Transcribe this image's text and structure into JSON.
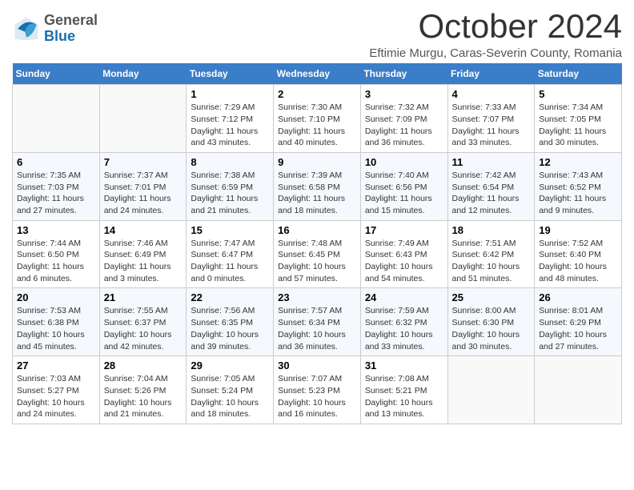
{
  "header": {
    "logo_general": "General",
    "logo_blue": "Blue",
    "month_title": "October 2024",
    "location": "Eftimie Murgu, Caras-Severin County, Romania"
  },
  "weekdays": [
    "Sunday",
    "Monday",
    "Tuesday",
    "Wednesday",
    "Thursday",
    "Friday",
    "Saturday"
  ],
  "weeks": [
    [
      {
        "day": "",
        "sunrise": "",
        "sunset": "",
        "daylight": ""
      },
      {
        "day": "",
        "sunrise": "",
        "sunset": "",
        "daylight": ""
      },
      {
        "day": "1",
        "sunrise": "Sunrise: 7:29 AM",
        "sunset": "Sunset: 7:12 PM",
        "daylight": "Daylight: 11 hours and 43 minutes."
      },
      {
        "day": "2",
        "sunrise": "Sunrise: 7:30 AM",
        "sunset": "Sunset: 7:10 PM",
        "daylight": "Daylight: 11 hours and 40 minutes."
      },
      {
        "day": "3",
        "sunrise": "Sunrise: 7:32 AM",
        "sunset": "Sunset: 7:09 PM",
        "daylight": "Daylight: 11 hours and 36 minutes."
      },
      {
        "day": "4",
        "sunrise": "Sunrise: 7:33 AM",
        "sunset": "Sunset: 7:07 PM",
        "daylight": "Daylight: 11 hours and 33 minutes."
      },
      {
        "day": "5",
        "sunrise": "Sunrise: 7:34 AM",
        "sunset": "Sunset: 7:05 PM",
        "daylight": "Daylight: 11 hours and 30 minutes."
      }
    ],
    [
      {
        "day": "6",
        "sunrise": "Sunrise: 7:35 AM",
        "sunset": "Sunset: 7:03 PM",
        "daylight": "Daylight: 11 hours and 27 minutes."
      },
      {
        "day": "7",
        "sunrise": "Sunrise: 7:37 AM",
        "sunset": "Sunset: 7:01 PM",
        "daylight": "Daylight: 11 hours and 24 minutes."
      },
      {
        "day": "8",
        "sunrise": "Sunrise: 7:38 AM",
        "sunset": "Sunset: 6:59 PM",
        "daylight": "Daylight: 11 hours and 21 minutes."
      },
      {
        "day": "9",
        "sunrise": "Sunrise: 7:39 AM",
        "sunset": "Sunset: 6:58 PM",
        "daylight": "Daylight: 11 hours and 18 minutes."
      },
      {
        "day": "10",
        "sunrise": "Sunrise: 7:40 AM",
        "sunset": "Sunset: 6:56 PM",
        "daylight": "Daylight: 11 hours and 15 minutes."
      },
      {
        "day": "11",
        "sunrise": "Sunrise: 7:42 AM",
        "sunset": "Sunset: 6:54 PM",
        "daylight": "Daylight: 11 hours and 12 minutes."
      },
      {
        "day": "12",
        "sunrise": "Sunrise: 7:43 AM",
        "sunset": "Sunset: 6:52 PM",
        "daylight": "Daylight: 11 hours and 9 minutes."
      }
    ],
    [
      {
        "day": "13",
        "sunrise": "Sunrise: 7:44 AM",
        "sunset": "Sunset: 6:50 PM",
        "daylight": "Daylight: 11 hours and 6 minutes."
      },
      {
        "day": "14",
        "sunrise": "Sunrise: 7:46 AM",
        "sunset": "Sunset: 6:49 PM",
        "daylight": "Daylight: 11 hours and 3 minutes."
      },
      {
        "day": "15",
        "sunrise": "Sunrise: 7:47 AM",
        "sunset": "Sunset: 6:47 PM",
        "daylight": "Daylight: 11 hours and 0 minutes."
      },
      {
        "day": "16",
        "sunrise": "Sunrise: 7:48 AM",
        "sunset": "Sunset: 6:45 PM",
        "daylight": "Daylight: 10 hours and 57 minutes."
      },
      {
        "day": "17",
        "sunrise": "Sunrise: 7:49 AM",
        "sunset": "Sunset: 6:43 PM",
        "daylight": "Daylight: 10 hours and 54 minutes."
      },
      {
        "day": "18",
        "sunrise": "Sunrise: 7:51 AM",
        "sunset": "Sunset: 6:42 PM",
        "daylight": "Daylight: 10 hours and 51 minutes."
      },
      {
        "day": "19",
        "sunrise": "Sunrise: 7:52 AM",
        "sunset": "Sunset: 6:40 PM",
        "daylight": "Daylight: 10 hours and 48 minutes."
      }
    ],
    [
      {
        "day": "20",
        "sunrise": "Sunrise: 7:53 AM",
        "sunset": "Sunset: 6:38 PM",
        "daylight": "Daylight: 10 hours and 45 minutes."
      },
      {
        "day": "21",
        "sunrise": "Sunrise: 7:55 AM",
        "sunset": "Sunset: 6:37 PM",
        "daylight": "Daylight: 10 hours and 42 minutes."
      },
      {
        "day": "22",
        "sunrise": "Sunrise: 7:56 AM",
        "sunset": "Sunset: 6:35 PM",
        "daylight": "Daylight: 10 hours and 39 minutes."
      },
      {
        "day": "23",
        "sunrise": "Sunrise: 7:57 AM",
        "sunset": "Sunset: 6:34 PM",
        "daylight": "Daylight: 10 hours and 36 minutes."
      },
      {
        "day": "24",
        "sunrise": "Sunrise: 7:59 AM",
        "sunset": "Sunset: 6:32 PM",
        "daylight": "Daylight: 10 hours and 33 minutes."
      },
      {
        "day": "25",
        "sunrise": "Sunrise: 8:00 AM",
        "sunset": "Sunset: 6:30 PM",
        "daylight": "Daylight: 10 hours and 30 minutes."
      },
      {
        "day": "26",
        "sunrise": "Sunrise: 8:01 AM",
        "sunset": "Sunset: 6:29 PM",
        "daylight": "Daylight: 10 hours and 27 minutes."
      }
    ],
    [
      {
        "day": "27",
        "sunrise": "Sunrise: 7:03 AM",
        "sunset": "Sunset: 5:27 PM",
        "daylight": "Daylight: 10 hours and 24 minutes."
      },
      {
        "day": "28",
        "sunrise": "Sunrise: 7:04 AM",
        "sunset": "Sunset: 5:26 PM",
        "daylight": "Daylight: 10 hours and 21 minutes."
      },
      {
        "day": "29",
        "sunrise": "Sunrise: 7:05 AM",
        "sunset": "Sunset: 5:24 PM",
        "daylight": "Daylight: 10 hours and 18 minutes."
      },
      {
        "day": "30",
        "sunrise": "Sunrise: 7:07 AM",
        "sunset": "Sunset: 5:23 PM",
        "daylight": "Daylight: 10 hours and 16 minutes."
      },
      {
        "day": "31",
        "sunrise": "Sunrise: 7:08 AM",
        "sunset": "Sunset: 5:21 PM",
        "daylight": "Daylight: 10 hours and 13 minutes."
      },
      {
        "day": "",
        "sunrise": "",
        "sunset": "",
        "daylight": ""
      },
      {
        "day": "",
        "sunrise": "",
        "sunset": "",
        "daylight": ""
      }
    ]
  ]
}
